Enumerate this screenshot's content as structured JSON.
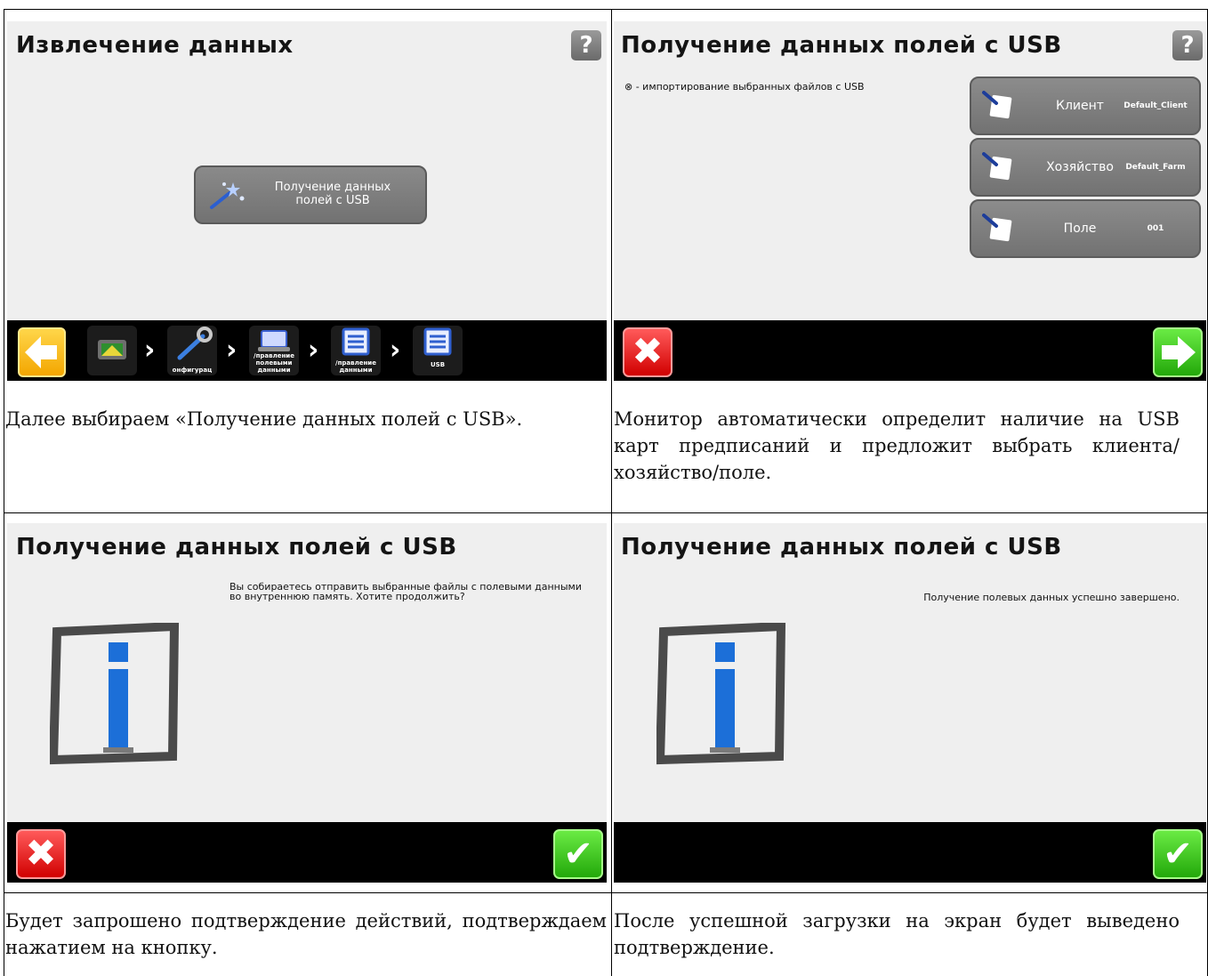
{
  "panel1": {
    "title": "Извлечение данных",
    "help": "?",
    "button_label": "Получение данных полей с USB",
    "crumbs": [
      {
        "label": "",
        "icon": "display-icon"
      },
      {
        "label": "онфигурац",
        "icon": "wrench-icon"
      },
      {
        "label": "/правление полевыми данными",
        "icon": "laptop-icon"
      },
      {
        "label": "/правление данными",
        "icon": "list-icon"
      },
      {
        "label": "USB",
        "icon": "list-icon"
      }
    ]
  },
  "panel2": {
    "title": "Получение данных полей с USB",
    "help": "?",
    "note": "⊗ - импортирование выбранных файлов с USB",
    "rows": [
      {
        "label": "Клиент",
        "value": "Default_Client"
      },
      {
        "label": "Хозяйство",
        "value": "Default_Farm"
      },
      {
        "label": "Поле",
        "value": "001"
      }
    ]
  },
  "panel3": {
    "title": "Получение данных полей с USB",
    "message": "Вы собираетесь отправить выбранные файлы с полевыми данными во внутреннюю память. Хотите продолжить?"
  },
  "panel4": {
    "title": "Получение данных полей с USB",
    "message": "Получение полевых данных успешно завершено."
  },
  "captions": {
    "c1": "Далее выбираем «Получение данных полей с USB».",
    "c2": "Монитор автоматически определит наличие на USB карт предписаний и предложит выбрать клиента/хозяйство/поле.",
    "c3": "Будет запрошено подтверждение действий, подтверждаем нажатием на кнопку.",
    "c4": "После успешной загрузки на экран будет выведено подтверждение."
  },
  "colors": {
    "accent_yellow": "#f3a600",
    "cancel_red": "#d10000",
    "ok_green": "#23a80a",
    "info_blue": "#1c6fd8"
  }
}
